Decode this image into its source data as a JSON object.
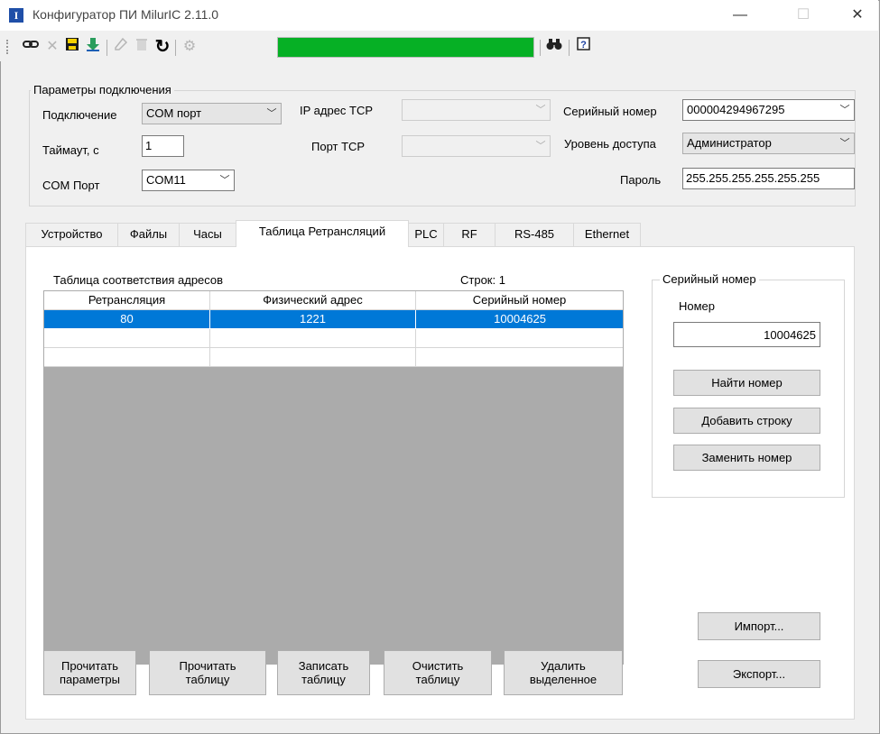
{
  "window": {
    "title": "Конфигуратор ПИ MilurIC 2.11.0",
    "app_icon": "I",
    "minimize": "—",
    "maximize": "☐",
    "close": "✕"
  },
  "toolbar": {
    "icons": [
      "link-icon",
      "disconnect-icon",
      "save-icon",
      "download-icon",
      "erase-icon",
      "trash-icon",
      "refresh-icon",
      "settings-icon",
      "binoculars-icon",
      "help-icon"
    ],
    "progress_color": "#06b025"
  },
  "connection": {
    "group_title": "Параметры подключения",
    "connection_label": "Подключение",
    "connection_value": "COM порт",
    "timeout_label": "Таймаут, с",
    "timeout_value": "1",
    "com_label": "COM Порт",
    "com_value": "COM11",
    "ip_label": "IP адрес TCP",
    "ip_value": "",
    "port_label": "Порт TCP",
    "port_value": "",
    "serial_label": "Серийный номер",
    "serial_value": "000004294967295",
    "access_label": "Уровень доступа",
    "access_value": "Администратор",
    "password_label": "Пароль",
    "password_value": "255.255.255.255.255.255"
  },
  "tabs": [
    {
      "label": "Устройство"
    },
    {
      "label": "Файлы"
    },
    {
      "label": "Часы"
    },
    {
      "label": "Таблица Ретрансляций"
    },
    {
      "label": "PLC"
    },
    {
      "label": "RF"
    },
    {
      "label": "RS-485"
    },
    {
      "label": "Ethernet"
    }
  ],
  "table": {
    "title": "Таблица соответствия адресов",
    "rows_count": "Строк: 1",
    "headers": [
      "Ретрансляция",
      "Физический адрес",
      "Серийный номер"
    ],
    "rows": [
      [
        "80",
        "1221",
        "10004625"
      ]
    ]
  },
  "serial_panel": {
    "group_title": "Серийный номер",
    "number_label": "Номер",
    "number_value": "10004625",
    "find_button": "Найти номер",
    "add_button": "Добавить строку",
    "replace_button": "Заменить номер"
  },
  "buttons": {
    "read_params_1": "Прочитать",
    "read_params_2": "параметры",
    "read_table_1": "Прочитать",
    "read_table_2": "таблицу",
    "write_table_1": "Записать",
    "write_table_2": "таблицу",
    "clear_table_1": "Очистить",
    "clear_table_2": "таблицу",
    "delete_sel_1": "Удалить",
    "delete_sel_2": "выделенное",
    "import": "Импорт...",
    "export": "Экспорт..."
  },
  "colors": {
    "selection": "#0078d7",
    "progress": "#06b025"
  }
}
